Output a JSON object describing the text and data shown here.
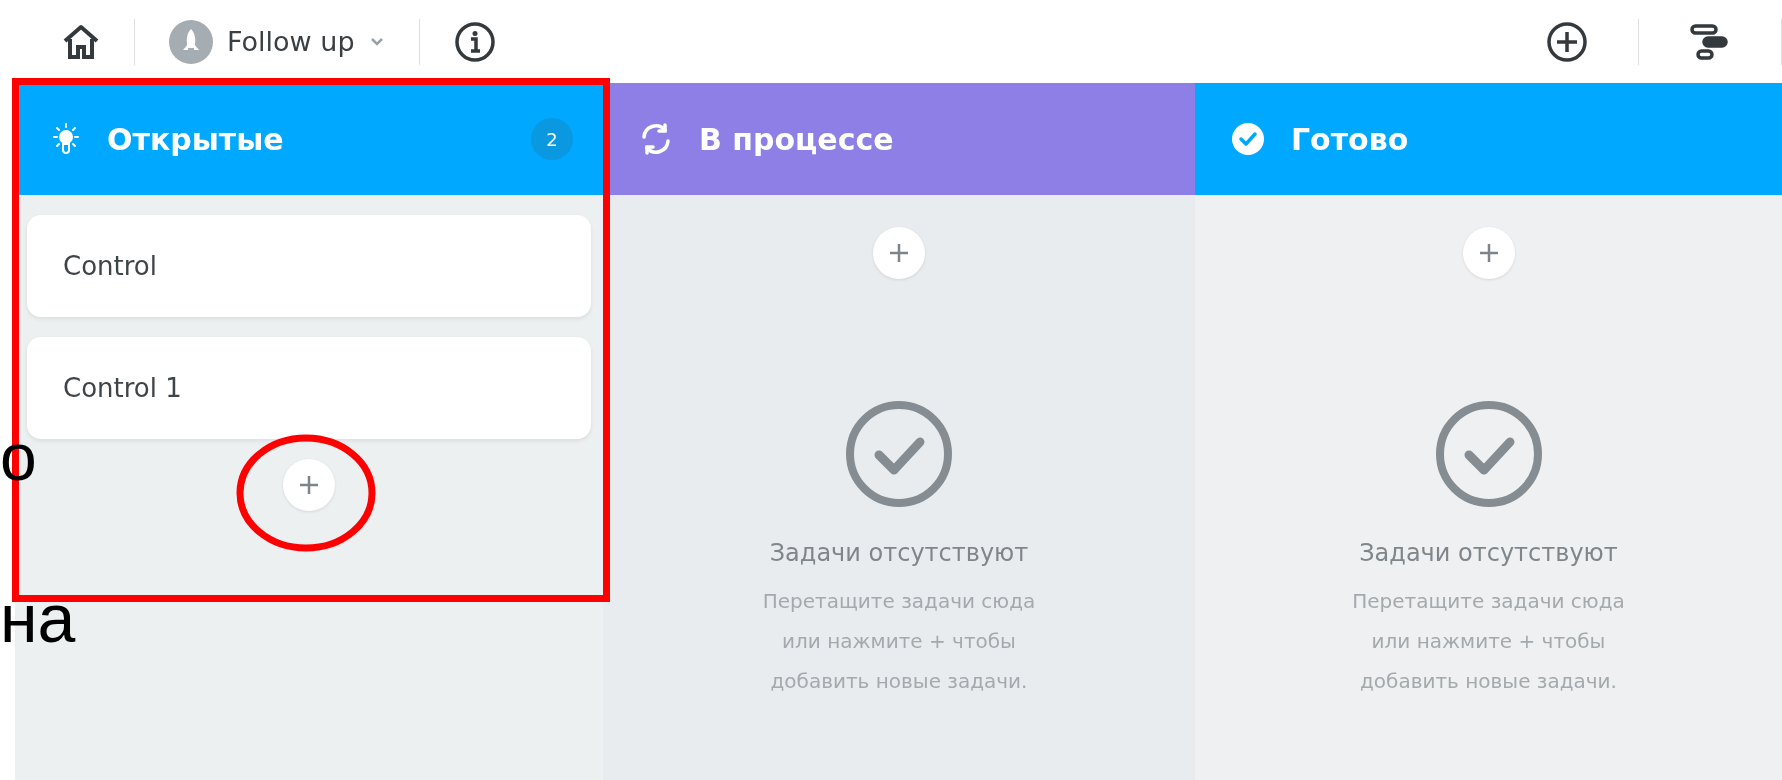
{
  "toolbar": {
    "project": "Follow up"
  },
  "columns": [
    {
      "title": "Открытые",
      "kind": "bulb",
      "color": "#00a8ff",
      "count": "2",
      "cards": [
        "Control",
        "Control 1"
      ]
    },
    {
      "title": "В процессе",
      "kind": "sync",
      "color": "#8e7fe6",
      "empty": {
        "title": "Задачи отсутствуют",
        "text": "Перетащите задачи сюда\nили нажмите + чтобы\nдобавить новые задачи."
      }
    },
    {
      "title": "Готово",
      "kind": "check",
      "color": "#00a8ff",
      "empty": {
        "title": "Задачи отсутствуют",
        "text": "Перетащите задачи сюда\nили нажмите + чтобы\nдобавить новые задачи."
      }
    }
  ],
  "annotations": [
    {
      "kind": "rectangle"
    },
    {
      "kind": "ellipse"
    }
  ],
  "fragments": [
    "о",
    "на"
  ]
}
